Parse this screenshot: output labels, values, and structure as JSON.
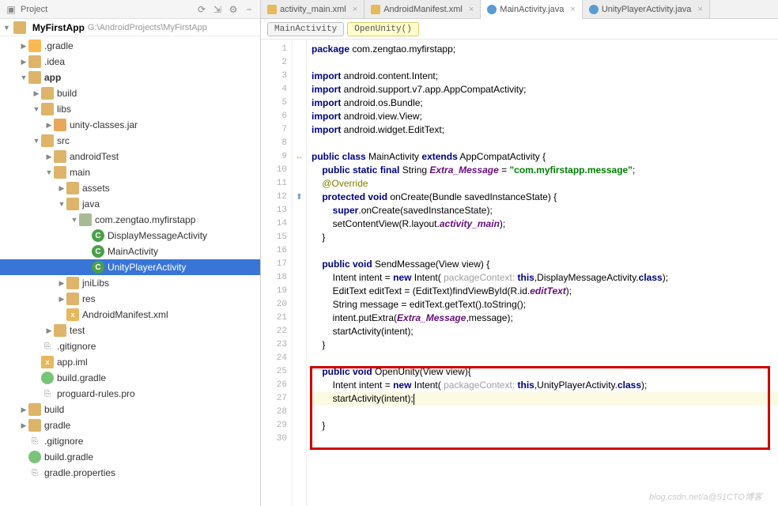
{
  "sidebar": {
    "header_title": "Project",
    "root_name": "MyFirstApp",
    "root_path": "G:\\AndroidProjects\\MyFirstApp",
    "items": [
      {
        "depth": 1,
        "arrow": "▶",
        "ico": "dir-o",
        "label": ".gradle"
      },
      {
        "depth": 1,
        "arrow": "▶",
        "ico": "dir",
        "label": ".idea"
      },
      {
        "depth": 1,
        "arrow": "▼",
        "ico": "dir",
        "label": "app",
        "bold": true
      },
      {
        "depth": 2,
        "arrow": "▶",
        "ico": "dir",
        "label": "build"
      },
      {
        "depth": 2,
        "arrow": "▼",
        "ico": "dir",
        "label": "libs"
      },
      {
        "depth": 3,
        "arrow": "▶",
        "ico": "jar",
        "label": "unity-classes.jar"
      },
      {
        "depth": 2,
        "arrow": "▼",
        "ico": "dir",
        "label": "src"
      },
      {
        "depth": 3,
        "arrow": "▶",
        "ico": "dir",
        "label": "androidTest"
      },
      {
        "depth": 3,
        "arrow": "▼",
        "ico": "dir",
        "label": "main"
      },
      {
        "depth": 4,
        "arrow": "▶",
        "ico": "dir",
        "label": "assets"
      },
      {
        "depth": 4,
        "arrow": "▼",
        "ico": "dir",
        "label": "java"
      },
      {
        "depth": 5,
        "arrow": "▼",
        "ico": "pkg",
        "label": "com.zengtao.myfirstapp"
      },
      {
        "depth": 6,
        "arrow": "",
        "ico": "class-c",
        "label": "DisplayMessageActivity"
      },
      {
        "depth": 6,
        "arrow": "",
        "ico": "class-c",
        "label": "MainActivity"
      },
      {
        "depth": 6,
        "arrow": "",
        "ico": "class-c",
        "label": "UnityPlayerActivity",
        "selected": true
      },
      {
        "depth": 4,
        "arrow": "▶",
        "ico": "dir",
        "label": "jniLibs"
      },
      {
        "depth": 4,
        "arrow": "▶",
        "ico": "dir",
        "label": "res"
      },
      {
        "depth": 4,
        "arrow": "",
        "ico": "xml",
        "label": "AndroidManifest.xml"
      },
      {
        "depth": 3,
        "arrow": "▶",
        "ico": "dir",
        "label": "test"
      },
      {
        "depth": 2,
        "arrow": "",
        "ico": "txt",
        "label": ".gitignore"
      },
      {
        "depth": 2,
        "arrow": "",
        "ico": "xml",
        "label": "app.iml"
      },
      {
        "depth": 2,
        "arrow": "",
        "ico": "gradle",
        "label": "build.gradle"
      },
      {
        "depth": 2,
        "arrow": "",
        "ico": "txt",
        "label": "proguard-rules.pro"
      },
      {
        "depth": 1,
        "arrow": "▶",
        "ico": "dir",
        "label": "build"
      },
      {
        "depth": 1,
        "arrow": "▶",
        "ico": "dir",
        "label": "gradle"
      },
      {
        "depth": 1,
        "arrow": "",
        "ico": "txt",
        "label": ".gitignore"
      },
      {
        "depth": 1,
        "arrow": "",
        "ico": "gradle",
        "label": "build.gradle"
      },
      {
        "depth": 1,
        "arrow": "",
        "ico": "txt",
        "label": "gradle.properties"
      }
    ]
  },
  "tabs": [
    {
      "ico": "xml",
      "label": "activity_main.xml",
      "active": false
    },
    {
      "ico": "xml",
      "label": "AndroidManifest.xml",
      "active": false
    },
    {
      "ico": "java",
      "label": "MainActivity.java",
      "active": true
    },
    {
      "ico": "java",
      "label": "UnityPlayerActivity.java",
      "active": false
    }
  ],
  "breadcrumb": [
    {
      "label": "MainActivity",
      "hl": false
    },
    {
      "label": "OpenUnity()",
      "hl": true
    }
  ],
  "code": {
    "lines": [
      {
        "n": 1,
        "mark": "",
        "html": "<span class='kw'>package</span> com.zengtao.myfirstapp;"
      },
      {
        "n": 2,
        "mark": "",
        "html": ""
      },
      {
        "n": 3,
        "mark": "",
        "html": "<span class='kw'>import</span> android.content.Intent;"
      },
      {
        "n": 4,
        "mark": "",
        "html": "<span class='kw'>import</span> android.support.v7.app.AppCompatActivity;"
      },
      {
        "n": 5,
        "mark": "",
        "html": "<span class='kw'>import</span> android.os.Bundle;"
      },
      {
        "n": 6,
        "mark": "",
        "html": "<span class='kw'>import</span> android.view.View;"
      },
      {
        "n": 7,
        "mark": "",
        "html": "<span class='kw'>import</span> android.widget.EditText;"
      },
      {
        "n": 8,
        "mark": "",
        "html": ""
      },
      {
        "n": 9,
        "mark": "↔",
        "html": "<span class='kw'>public class</span> MainActivity <span class='kw'>extends</span> AppCompatActivity {"
      },
      {
        "n": 10,
        "mark": "",
        "html": "    <span class='kw'>public static final</span> String <span class='fld'>Extra_Message</span> = <span class='str'>\"com.myfirstapp.message\"</span>;"
      },
      {
        "n": 11,
        "mark": "",
        "html": "    <span class='ann'>@Override</span>"
      },
      {
        "n": 12,
        "mark": "⬆",
        "html": "    <span class='kw'>protected void</span> onCreate(Bundle savedInstanceState) {"
      },
      {
        "n": 13,
        "mark": "",
        "html": "        <span class='kw'>super</span>.onCreate(savedInstanceState);"
      },
      {
        "n": 14,
        "mark": "",
        "html": "        setContentView(R.layout.<span class='fld'>activity_main</span>);"
      },
      {
        "n": 15,
        "mark": "",
        "html": "    }"
      },
      {
        "n": 16,
        "mark": "",
        "html": ""
      },
      {
        "n": 17,
        "mark": "",
        "html": "    <span class='kw'>public void</span> SendMessage(View view) {"
      },
      {
        "n": 18,
        "mark": "",
        "html": "        Intent intent = <span class='kw'>new</span> Intent( <span class='param-hint'>packageContext:</span> <span class='kw'>this</span>,DisplayMessageActivity.<span class='kw'>class</span>);"
      },
      {
        "n": 19,
        "mark": "",
        "html": "        EditText editText = (EditText)findViewById(R.id.<span class='fld'>editText</span>);"
      },
      {
        "n": 20,
        "mark": "",
        "html": "        String message = editText.getText().toString();"
      },
      {
        "n": 21,
        "mark": "",
        "html": "        intent.putExtra(<span class='fld'>Extra_Message</span>,message);"
      },
      {
        "n": 22,
        "mark": "",
        "html": "        startActivity(intent);"
      },
      {
        "n": 23,
        "mark": "",
        "html": "    }"
      },
      {
        "n": 24,
        "mark": "",
        "html": ""
      },
      {
        "n": 25,
        "mark": "",
        "html": "    <span class='kw'>public void</span> OpenUnity(View view){"
      },
      {
        "n": 26,
        "mark": "",
        "html": "        Intent intent = <span class='kw'>new</span> Intent( <span class='param-hint'>packageContext:</span> <span class='kw'>this</span>,UnityPlayerActivity.<span class='kw'>class</span>);"
      },
      {
        "n": 27,
        "mark": "",
        "hl": true,
        "html": "        startActivity(intent);<span style='border-left:1px solid #000;display:inline-block;height:14px;vertical-align:middle'></span>"
      },
      {
        "n": 28,
        "mark": "",
        "html": ""
      },
      {
        "n": 29,
        "mark": "",
        "html": "    }"
      },
      {
        "n": 30,
        "mark": "",
        "html": ""
      }
    ]
  },
  "watermark": "blog.csdn.net/a@51CTO博客"
}
